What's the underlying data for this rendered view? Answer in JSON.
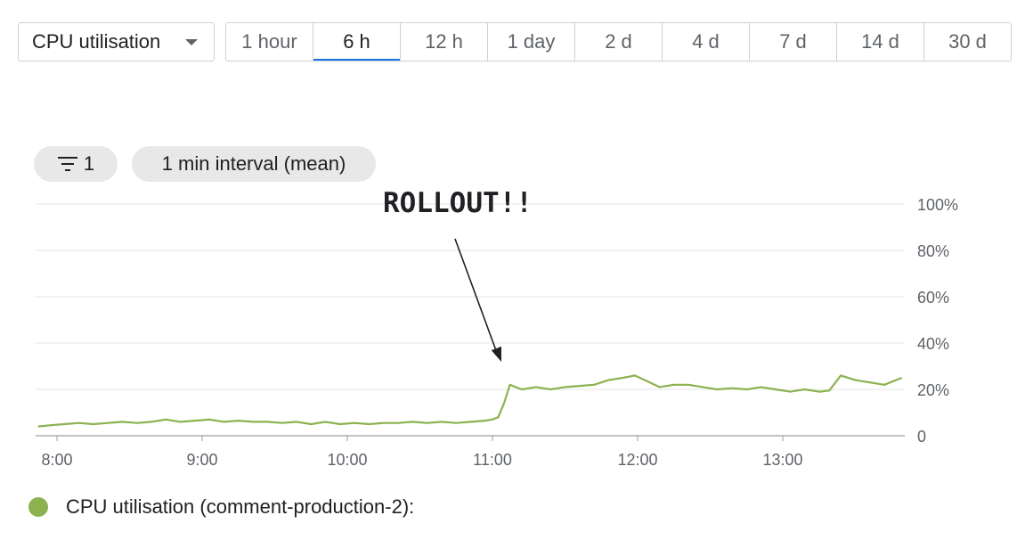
{
  "toolbar": {
    "metric_label": "CPU utilisation",
    "ranges": [
      "1 hour",
      "6 h",
      "12 h",
      "1 day",
      "2 d",
      "4 d",
      "7 d",
      "14 d",
      "30 d"
    ],
    "active_range": "6 h"
  },
  "chips": {
    "filter_count": "1",
    "interval_label": "1 min interval (mean)"
  },
  "annotation": {
    "text": "ROLLOUT!!"
  },
  "legend": {
    "label": "CPU utilisation (comment-production-2):"
  },
  "colors": {
    "series": "#8bb24f",
    "accent": "#1a73e8",
    "grid": "#e6e6e6"
  },
  "chart_data": {
    "type": "line",
    "y_axis": {
      "min": 0,
      "max": 100,
      "position": "right",
      "ticks": [
        0,
        20,
        40,
        60,
        80,
        100
      ],
      "tick_labels": [
        "0",
        "20%",
        "40%",
        "60%",
        "80%",
        "100%"
      ]
    },
    "x_axis": {
      "min_hours": 7.87,
      "max_hours": 13.82,
      "ticks_hours": [
        8,
        9,
        10,
        11,
        12,
        13
      ],
      "tick_labels": [
        "8:00",
        "9:00",
        "10:00",
        "11:00",
        "12:00",
        "13:00"
      ]
    },
    "grid": true,
    "series": [
      {
        "name": "CPU utilisation (comment-production-2)",
        "color": "#8bb24f",
        "x_hours": [
          7.87,
          7.95,
          8.05,
          8.15,
          8.25,
          8.35,
          8.45,
          8.55,
          8.65,
          8.75,
          8.85,
          8.95,
          9.05,
          9.15,
          9.25,
          9.35,
          9.45,
          9.55,
          9.65,
          9.75,
          9.85,
          9.95,
          10.05,
          10.15,
          10.25,
          10.35,
          10.45,
          10.55,
          10.65,
          10.75,
          10.85,
          10.95,
          11.0,
          11.04,
          11.08,
          11.12,
          11.2,
          11.3,
          11.4,
          11.5,
          11.6,
          11.7,
          11.8,
          11.9,
          11.98,
          12.05,
          12.15,
          12.25,
          12.35,
          12.45,
          12.55,
          12.65,
          12.75,
          12.85,
          12.95,
          13.05,
          13.15,
          13.25,
          13.32,
          13.4,
          13.5,
          13.6,
          13.7,
          13.78,
          13.82
        ],
        "values": [
          4,
          4.5,
          5,
          5.5,
          5,
          5.5,
          6,
          5.5,
          6,
          7,
          6,
          6.5,
          7,
          6,
          6.5,
          6,
          6,
          5.5,
          6,
          5,
          6,
          5,
          5.5,
          5,
          5.5,
          5.5,
          6,
          5.5,
          6,
          5.5,
          6,
          6.5,
          7,
          8,
          14,
          22,
          20,
          21,
          20,
          21,
          21.5,
          22,
          24,
          25,
          26,
          24,
          21,
          22,
          22,
          21,
          20,
          20.5,
          20,
          21,
          20,
          19,
          20,
          19,
          19.5,
          26,
          24,
          23,
          22,
          24,
          25
        ]
      }
    ],
    "annotations": [
      {
        "text": "ROLLOUT!!",
        "points_to_hours": 11.04,
        "points_to_value": 35
      }
    ]
  }
}
